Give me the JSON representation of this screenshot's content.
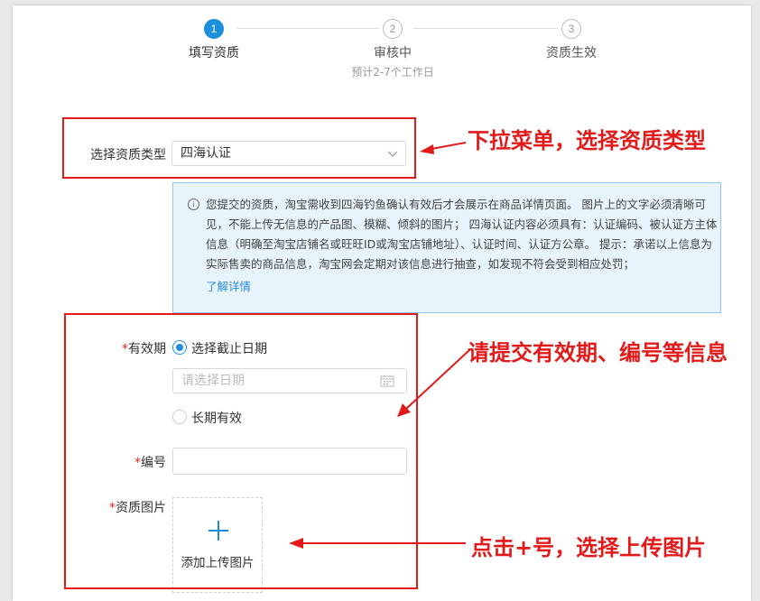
{
  "steps": [
    {
      "number": "1",
      "title": "填写资质",
      "subtitle": ""
    },
    {
      "number": "2",
      "title": "审核中",
      "subtitle": "预计2-7个工作日"
    },
    {
      "number": "3",
      "title": "资质生效",
      "subtitle": ""
    }
  ],
  "qualification_type": {
    "label": "选择资质类型",
    "value": "四海认证"
  },
  "notice": {
    "text": "您提交的资质，淘宝需收到四海钓鱼确认有效后才会展示在商品详情页面。 图片上的文字必须清晰可见，不能上传无信息的产品图、模糊、倾斜的图片； 四海认证内容必须具有：认证编码、被认证方主体信息（明确至淘宝店铺名或旺旺ID或淘宝店铺地址）、认证时间、认证方公章。 提示：承诺以上信息为实际售卖的商品信息，淘宝网会定期对该信息进行抽查，如发现不符会受到相应处罚；",
    "link": "了解详情"
  },
  "validity": {
    "required_mark": "*",
    "label": "有效期",
    "option_deadline": "选择截止日期",
    "date_placeholder": "请选择日期",
    "option_long_term": "长期有效"
  },
  "number_field": {
    "required_mark": "*",
    "label": "编号",
    "value": ""
  },
  "image_field": {
    "required_mark": "*",
    "label": "资质图片",
    "upload_label": "添加上传图片"
  },
  "annotations": {
    "select_type": "下拉菜单，选择资质类型",
    "submit_info": "请提交有效期、编号等信息",
    "upload_image": "点击+号，选择上传图片"
  },
  "colors": {
    "accent": "#1c8fdc",
    "annotation_red": "#e21a1a",
    "notice_bg": "#e8f4fc"
  }
}
